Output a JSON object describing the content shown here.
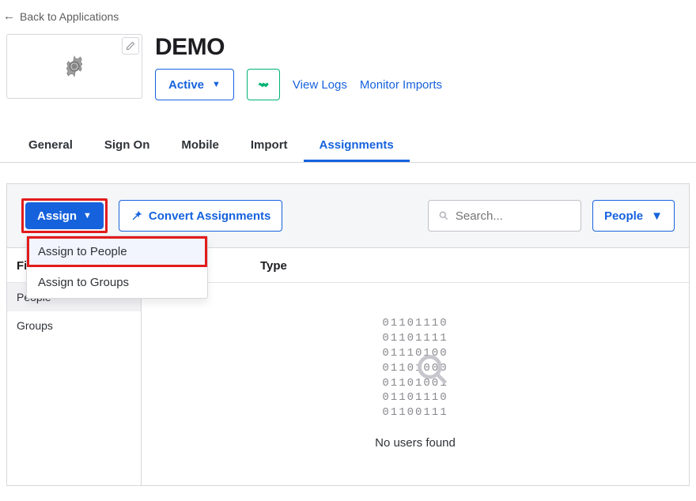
{
  "back_link": "Back to Applications",
  "app_title": "DEMO",
  "status_btn": "Active",
  "links": {
    "view_logs": "View Logs",
    "monitor_imports": "Monitor Imports"
  },
  "tabs": {
    "general": "General",
    "sign_on": "Sign On",
    "mobile": "Mobile",
    "import": "Import",
    "assignments": "Assignments"
  },
  "toolbar": {
    "assign": "Assign",
    "convert": "Convert Assignments",
    "search_placeholder": "Search...",
    "people_filter": "People"
  },
  "dropdown": {
    "assign_people": "Assign to People",
    "assign_groups": "Assign to Groups"
  },
  "sidebar": {
    "header": "Filters",
    "people": "People",
    "groups": "Groups"
  },
  "main": {
    "type_header": "Type",
    "binary_lines": [
      "01101110",
      "01101111",
      "01110100",
      "01101000",
      "01101001",
      "01101110",
      "01100111"
    ],
    "empty_message": "No users found"
  }
}
